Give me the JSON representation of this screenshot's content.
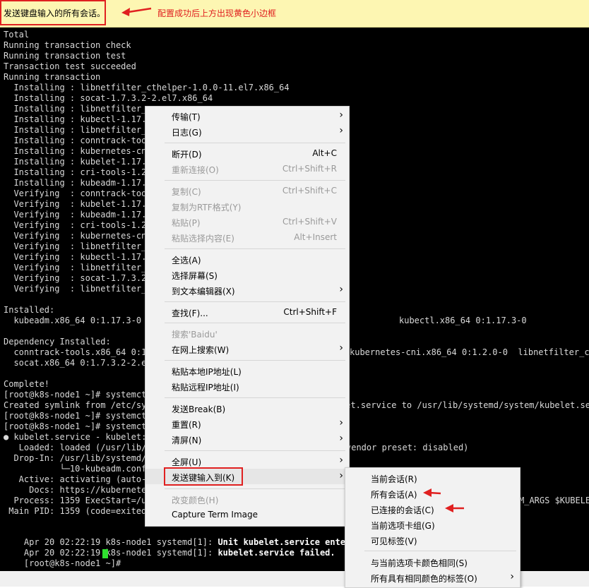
{
  "top_bar": {
    "broadcast_label": "发送键盘输入的所有会话。",
    "annotation_note": "配置成功后上方出现黄色小边框"
  },
  "terminal": {
    "lines": [
      "Total",
      "Running transaction check",
      "Running transaction test",
      "Transaction test succeeded",
      "Running transaction",
      "  Installing : libnetfilter_cthelper-1.0.0-11.el7.x86_64",
      "  Installing : socat-1.7.3.2-2.el7.x86_64",
      "  Installing : libnetfilter_c",
      "  Installing : kubectl-1.17.3",
      "  Installing : libnetfilter_c",
      "  Installing : conntrack-tool",
      "  Installing : kubernetes-cni",
      "  Installing : kubelet-1.17.3",
      "  Installing : cri-tools-1.20",
      "  Installing : kubeadm-1.17.3",
      "  Verifying  : conntrack-tool",
      "  Verifying  : kubelet-1.17.3",
      "  Verifying  : kubeadm-1.17.3",
      "  Verifying  : cri-tools-1.20",
      "  Verifying  : kubernetes-cni",
      "  Verifying  : libnetfilter_c",
      "  Verifying  : kubectl-1.17.3",
      "  Verifying  : libnetfilter_c",
      "  Verifying  : socat-1.7.3.2-",
      "  Verifying  : libnetfilter_c",
      "",
      "Installed:",
      "  kubeadm.x86_64 0:1.17.3-0",
      "",
      "Dependency Installed:",
      "  conntrack-tools.x86_64 0:1",
      "  socat.x86_64 0:1.7.3.2-2.el",
      "",
      "Complete!",
      "[root@k8s-node1 ~]# systemctl",
      "Created symlink from /etc/sys",
      "[root@k8s-node1 ~]# systemctl",
      "[root@k8s-node1 ~]# systemctl",
      "● kubelet.service - kubelet:",
      "   Loaded: loaded (/usr/lib/s",
      "  Drop-In: /usr/lib/systemd/s",
      "           └─10-kubeadm.conf",
      "   Active: activating (auto-r",
      "     Docs: https://kubernetes",
      "  Process: 1359 ExecStart=/us",
      " Main PID: 1359 (code=exited,"
    ],
    "right_fragments": [
      {
        "text": "kubectl.x86_64 0:1.17.3-0",
        "line": 27
      },
      {
        "text": "kubernetes-cni.x86_64 0:1.2.0-0  libnetfilter_cthe",
        "line": 30
      },
      {
        "text": "let.service to /usr/lib/systemd/system/kubelet.ser",
        "line": 35
      },
      {
        "text": "vendor preset: disabled)",
        "line": 39
      },
      {
        "text": "M_ARGS $KUBELET",
        "line": 44
      }
    ],
    "bottom_lines": [
      {
        "prefix": "Apr 20 02:22:19 k8s-node1 systemd[1]: ",
        "bold": "Unit kubelet.service entered fa"
      },
      {
        "prefix": "Apr 20 02:22:19 k8s-node1 systemd[1]: ",
        "bold": "kubelet.service failed."
      }
    ],
    "prompt": "[root@k8s-node1 ~]# "
  },
  "context_menu": {
    "items": [
      {
        "label": "传输(T)",
        "shortcut": "",
        "submenu": true,
        "disabled": false
      },
      {
        "label": "日志(G)",
        "shortcut": "",
        "submenu": true,
        "disabled": false
      },
      {
        "label": "断开(D)",
        "shortcut": "Alt+C",
        "submenu": false,
        "disabled": false
      },
      {
        "label": "重新连接(O)",
        "shortcut": "Ctrl+Shift+R",
        "submenu": false,
        "disabled": true
      },
      {
        "label": "复制(C)",
        "shortcut": "Ctrl+Shift+C",
        "submenu": false,
        "disabled": true
      },
      {
        "label": "复制为RTF格式(Y)",
        "shortcut": "",
        "submenu": false,
        "disabled": true
      },
      {
        "label": "粘贴(P)",
        "shortcut": "Ctrl+Shift+V",
        "submenu": false,
        "disabled": true
      },
      {
        "label": "粘贴选择内容(E)",
        "shortcut": "Alt+Insert",
        "submenu": false,
        "disabled": true
      },
      {
        "label": "全选(A)",
        "shortcut": "",
        "submenu": false,
        "disabled": false
      },
      {
        "label": "选择屏幕(S)",
        "shortcut": "",
        "submenu": false,
        "disabled": false
      },
      {
        "label": "到文本编辑器(X)",
        "shortcut": "",
        "submenu": true,
        "disabled": false
      },
      {
        "label": "查找(F)...",
        "shortcut": "Ctrl+Shift+F",
        "submenu": false,
        "disabled": false
      },
      {
        "label": "搜索'Baidu'",
        "shortcut": "",
        "submenu": false,
        "disabled": true
      },
      {
        "label": "在网上搜索(W)",
        "shortcut": "",
        "submenu": true,
        "disabled": false
      },
      {
        "label": "粘贴本地IP地址(L)",
        "shortcut": "",
        "submenu": false,
        "disabled": false
      },
      {
        "label": "粘贴远程IP地址(I)",
        "shortcut": "",
        "submenu": false,
        "disabled": false
      },
      {
        "label": "发送Break(B)",
        "shortcut": "",
        "submenu": false,
        "disabled": false
      },
      {
        "label": "重置(R)",
        "shortcut": "",
        "submenu": true,
        "disabled": false
      },
      {
        "label": "清屏(N)",
        "shortcut": "",
        "submenu": true,
        "disabled": false
      },
      {
        "label": "全屏(U)",
        "shortcut": "",
        "submenu": true,
        "disabled": false
      },
      {
        "label": "发送键输入到(K)",
        "shortcut": "",
        "submenu": true,
        "disabled": false
      },
      {
        "label": "改变颜色(H)",
        "shortcut": "",
        "submenu": false,
        "disabled": true
      },
      {
        "label": "Capture Term Image",
        "shortcut": "",
        "submenu": false,
        "disabled": false
      }
    ]
  },
  "submenu": {
    "items": [
      {
        "label": "当前会话(R)"
      },
      {
        "label": "所有会话(A)"
      },
      {
        "label": "已连接的会话(C)"
      },
      {
        "label": "当前选项卡组(G)"
      },
      {
        "label": "可见标签(V)"
      },
      {
        "label": "与当前选项卡颜色相同(S)"
      },
      {
        "label": "所有具有相同颜色的标签(O)"
      }
    ]
  },
  "colors": {
    "annotation_red": "#e02020",
    "topbar_yellow": "#fdf6b2",
    "cursor_green": "#2fe02f"
  }
}
